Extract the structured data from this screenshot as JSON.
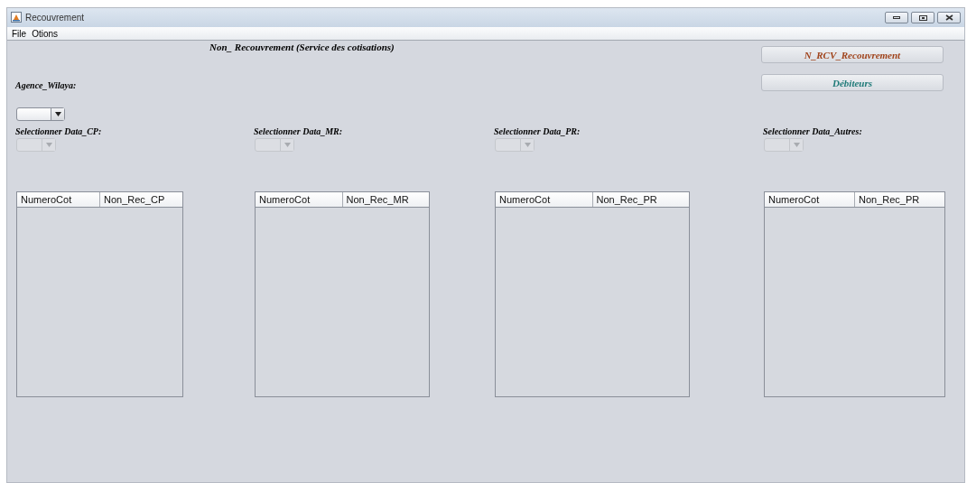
{
  "window": {
    "title": "Recouvrement"
  },
  "menu": [
    "File",
    "Otions"
  ],
  "heading": "Non_ Recouvrement  (Service des cotisations)",
  "buttons": [
    {
      "label": "N_RCV_Recouvrement",
      "color": "#a0441c"
    },
    {
      "label": "Débiteurs",
      "color": "#1f7a78"
    }
  ],
  "agence": {
    "label": "Agence_Wilaya:",
    "disabled": false
  },
  "sections": [
    {
      "label": "Selectionner Data_CP:",
      "disabled": true,
      "columns": [
        "NumeroCot",
        "Non_Rec_CP"
      ]
    },
    {
      "label": "Selectionner Data_MR:",
      "disabled": true,
      "columns": [
        "NumeroCot",
        "Non_Rec_MR"
      ]
    },
    {
      "label": "Selectionner Data_PR:",
      "disabled": true,
      "columns": [
        "NumeroCot",
        "Non_Rec_PR"
      ]
    },
    {
      "label": "Selectionner Data_Autres:",
      "disabled": true,
      "columns": [
        "NumeroCot",
        "Non_Rec_PR"
      ]
    }
  ]
}
